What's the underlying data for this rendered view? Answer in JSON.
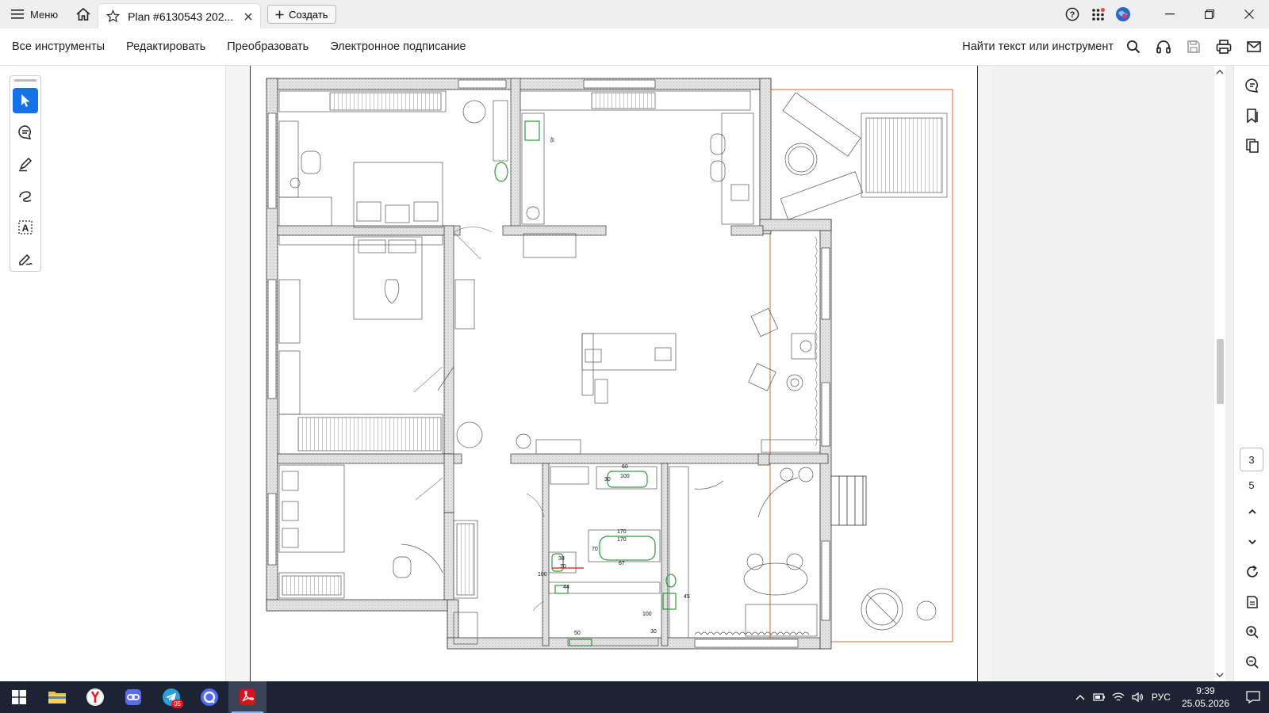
{
  "titlebar": {
    "menu_label": "Меню",
    "tab_title": "Plan #6130543 202...",
    "create_label": "Создать"
  },
  "toolbar": {
    "items": [
      "Все инструменты",
      "Редактировать",
      "Преобразовать",
      "Электронное подписание"
    ],
    "find_label": "Найти текст или инструмент"
  },
  "left_tools": [
    "select-cursor-icon",
    "add-comment-icon",
    "highlight-pen-icon",
    "draw-freeform-icon",
    "text-recognition-icon",
    "fill-sign-icon"
  ],
  "right_rail": {
    "current_page": "3",
    "total_pages": "5"
  },
  "taskbar": {
    "apps": [
      "file-explorer-icon",
      "yandex-browser-icon",
      "app-link-icon",
      "telegram-icon",
      "messenger-icon",
      "acrobat-icon"
    ],
    "telegram_badge": "05",
    "language": "РУС",
    "time": "9:39",
    "date": "25.05.2026"
  },
  "floorplan_dims": [
    "170",
    "170",
    "70",
    "67",
    "100",
    "60",
    "30",
    "38",
    "70",
    "100",
    "44",
    "50",
    "30",
    "100",
    "45",
    "45"
  ],
  "colors": {
    "accent": "#1473e6",
    "plan_green": "#2e9b3a",
    "terrace_border": "#d2693c",
    "taskbar": "#1c2433"
  }
}
